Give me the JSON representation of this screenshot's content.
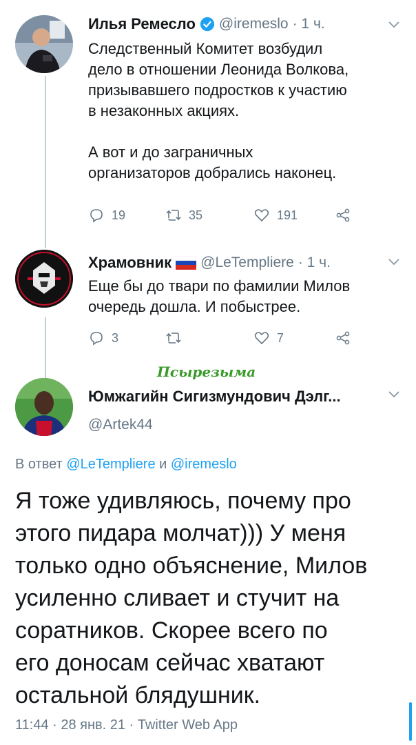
{
  "tweet1": {
    "author_name": "Илья Ремесло",
    "handle": "@iremeslo",
    "time": "· 1 ч.",
    "text_lines": [
      "Следственный Комитет возбудил",
      "дело в отношении Леонида Волкова,",
      "призывавшего подростков к участию",
      "в незаконных акциях."
    ],
    "text_lines2": [
      "А вот и до заграничных",
      "организаторов добрались наконец."
    ],
    "replies": "19",
    "retweets": "35",
    "likes": "191"
  },
  "tweet2": {
    "author_name": "Храмовник",
    "handle": "@LeTempliere",
    "time": "· 1 ч.",
    "text_lines": [
      "Еще бы до твари по фамилии Милов",
      "очередь дошла. И побыстрее."
    ],
    "replies": "3",
    "retweets": "",
    "likes": "7"
  },
  "watermark": "Псырезыма",
  "tweet3": {
    "author_name": "Юмжагийн Сигизмундович Дэлг...",
    "handle": "@Artek44",
    "reply_prefix": "В ответ",
    "reply_to_1": "@LeTempliere",
    "reply_and": "и",
    "reply_to_2": "@iremeslo",
    "text_lines": [
      "Я тоже удивляюсь, почему про",
      "этого пидара молчат))) У меня",
      "только одно объяснение, Милов",
      "усиленно сливает и стучит на",
      "соратников. Скорее всего по",
      "его доносам сейчас хватают",
      "остальной блядушник."
    ],
    "footer": "11:44 · 28 янв. 21 · Twitter Web App"
  },
  "colors": {
    "accent": "#1da1f2",
    "secondary": "#657786",
    "line": "#c4cfd6",
    "watermark": "#3a9a2a"
  }
}
